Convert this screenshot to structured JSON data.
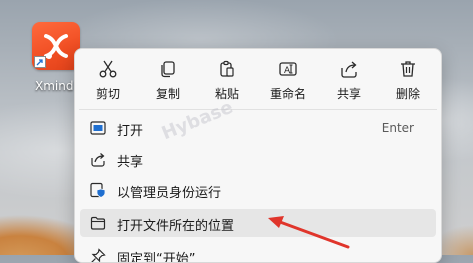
{
  "desktop": {
    "icon_label": "Xmind",
    "icon_name": "xmind-app-icon"
  },
  "toolbar": {
    "items": [
      {
        "label": "剪切",
        "icon": "cut-icon"
      },
      {
        "label": "复制",
        "icon": "copy-icon"
      },
      {
        "label": "粘贴",
        "icon": "paste-icon"
      },
      {
        "label": "重命名",
        "icon": "rename-icon"
      },
      {
        "label": "共享",
        "icon": "share-icon"
      },
      {
        "label": "删除",
        "icon": "delete-icon"
      }
    ]
  },
  "menu": {
    "items": [
      {
        "label": "打开",
        "accelerator": "Enter",
        "icon": "open-icon"
      },
      {
        "label": "共享",
        "accelerator": "",
        "icon": "share-icon"
      },
      {
        "label": "以管理员身份运行",
        "accelerator": "",
        "icon": "shield-icon"
      },
      {
        "label": "打开文件所在的位置",
        "accelerator": "",
        "icon": "folder-icon"
      },
      {
        "label": "固定到“开始”",
        "accelerator": "",
        "icon": "pin-icon"
      }
    ]
  },
  "watermark": {
    "line1": "Hybase",
    "line2": "Hybase"
  },
  "colors": {
    "app_tile": "#f04e23",
    "annotation_arrow": "#e0352b",
    "menu_bg": "#f7f7f7",
    "highlight": "#e6e6e6"
  }
}
